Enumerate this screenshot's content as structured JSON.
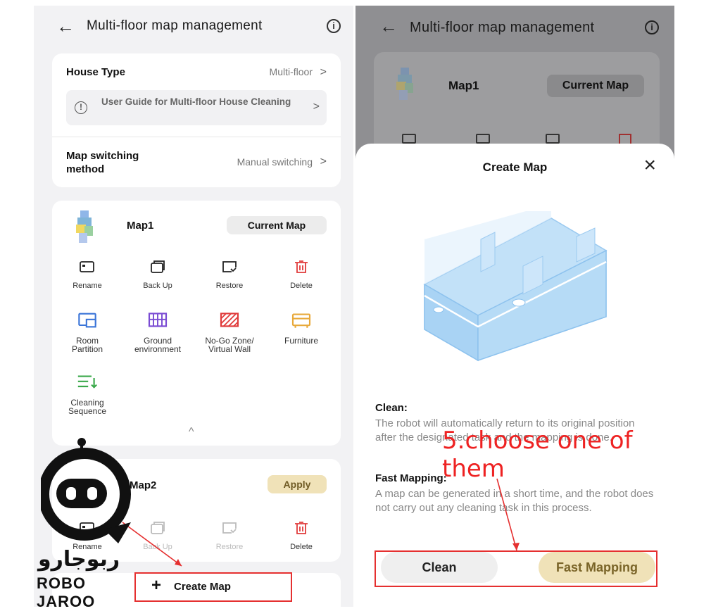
{
  "left": {
    "header": {
      "back": "←",
      "title": "Multi-floor map management",
      "info": "i"
    },
    "house_type": {
      "label": "House Type",
      "value": "Multi-floor",
      "chevron": ">"
    },
    "guide": {
      "icon": "!",
      "text": "User Guide for Multi-floor House Cleaning",
      "chevron": ">"
    },
    "switching": {
      "label": "Map switching method",
      "value": "Manual switching",
      "chevron": ">"
    },
    "map1": {
      "name": "Map1",
      "badge": "Current Map",
      "tools": [
        {
          "label": "Rename",
          "icon": "rename-icon",
          "color": "#222222"
        },
        {
          "label": "Back Up",
          "icon": "backup-icon",
          "color": "#222222"
        },
        {
          "label": "Restore",
          "icon": "restore-icon",
          "color": "#222222"
        },
        {
          "label": "Delete",
          "icon": "delete-icon",
          "color": "#e03a3a"
        }
      ],
      "features": [
        {
          "label": "Room Partition",
          "icon": "room-partition-icon",
          "color": "#3a74d8"
        },
        {
          "label": "Ground environment",
          "icon": "ground-environment-icon",
          "color": "#7a4bd3"
        },
        {
          "label": "No-Go Zone/ Virtual Wall",
          "icon": "no-go-zone-icon",
          "color": "#e03a3a"
        },
        {
          "label": "Furniture",
          "icon": "furniture-icon",
          "color": "#e8a93a"
        },
        {
          "label": "Cleaning Sequence",
          "icon": "cleaning-sequence-icon",
          "color": "#3aa84a"
        }
      ],
      "collapse": "^"
    },
    "map2": {
      "name": "Map2",
      "action": "Apply",
      "tools": [
        {
          "label": "Rename",
          "icon": "rename-icon"
        },
        {
          "label": "Back Up",
          "icon": "backup-icon"
        },
        {
          "label": "Restore",
          "icon": "restore-icon"
        },
        {
          "label": "Delete",
          "icon": "delete-icon"
        }
      ]
    },
    "create_map": {
      "plus": "+",
      "label": "Create Map"
    }
  },
  "right": {
    "header": {
      "back": "←",
      "title": "Multi-floor map management",
      "info": "i"
    },
    "map1": {
      "name": "Map1",
      "badge": "Current Map"
    },
    "sheet": {
      "title": "Create Map",
      "close": "×",
      "clean": {
        "heading": "Clean:",
        "text": "The robot will automatically return to its original position after the designated task and the mapping is done."
      },
      "fast": {
        "heading": "Fast Mapping:",
        "text": "A map can be generated in a short time, and the robot does not carry out any cleaning task in this process."
      },
      "buttons": {
        "clean": "Clean",
        "fast": "Fast Mapping"
      }
    }
  },
  "annotation": {
    "text": "5.choose one of them",
    "color": "#ee2222"
  },
  "logo": {
    "persian": "ربوجارو",
    "english": "ROBO JAROO"
  },
  "colors": {
    "accent_gold": "#f0e2b8",
    "delete_red": "#e03a3a",
    "annotation_red": "#e53030"
  }
}
